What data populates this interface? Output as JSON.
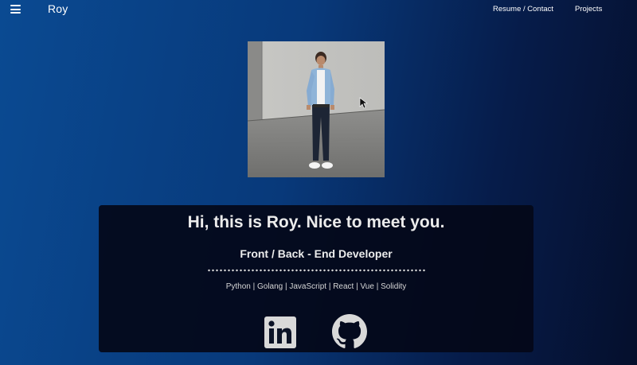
{
  "header": {
    "brand": "Roy",
    "nav": [
      {
        "label": "Resume / Contact"
      },
      {
        "label": "Projects"
      }
    ]
  },
  "hero": {
    "photo_icon": "profile-photo"
  },
  "card": {
    "greeting": "Hi, this is Roy. Nice to meet you.",
    "role": "Front / Back - End Developer",
    "skills": "Python | Golang | JavaScript | React | Vue | Solidity",
    "social": [
      {
        "icon": "linkedin-icon"
      },
      {
        "icon": "github-icon"
      }
    ]
  },
  "colors": {
    "background_start": "#0a4a92",
    "background_end": "#050f2c",
    "card_background": "#040818",
    "text": "#ececec"
  }
}
